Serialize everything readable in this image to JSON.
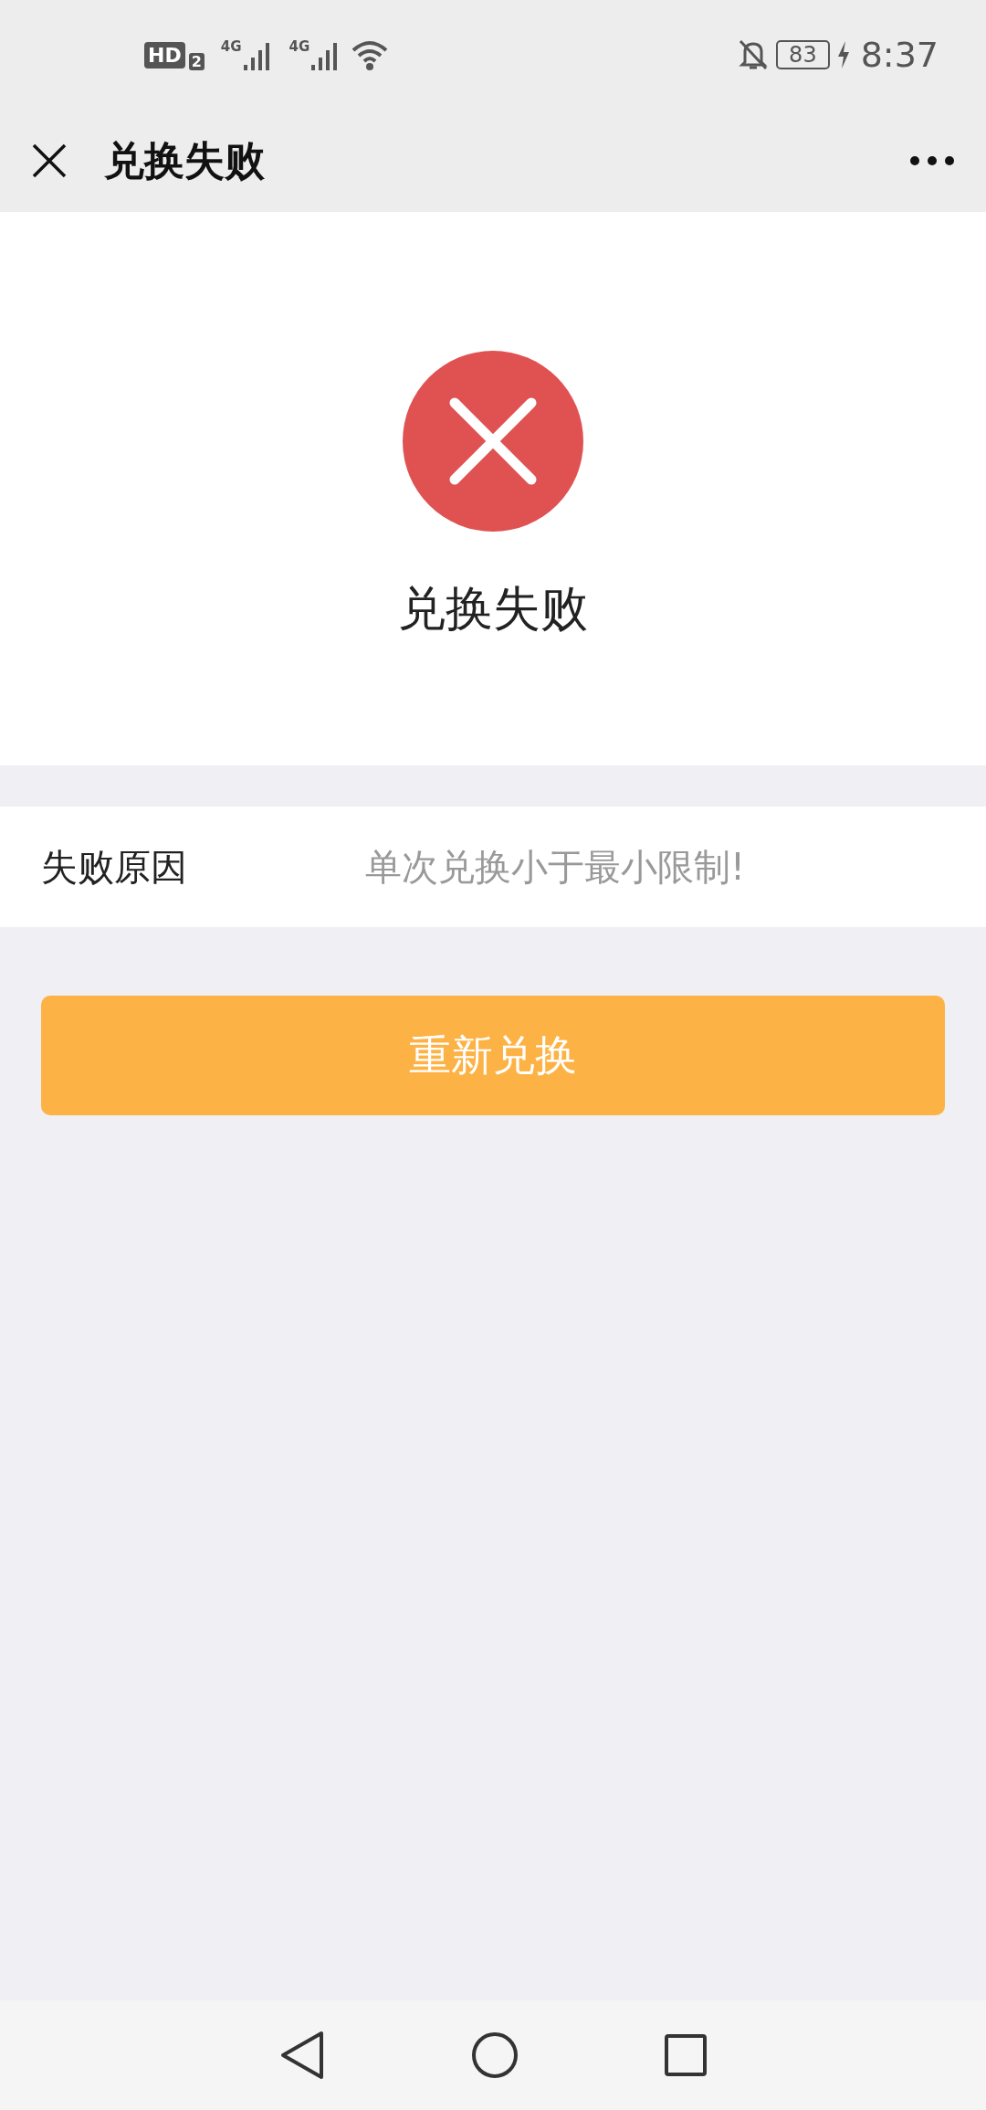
{
  "status_bar": {
    "hd_badge": "HD",
    "sim_number": "2",
    "network_1": "4G",
    "network_2": "4G",
    "battery": "83",
    "time": "8:37"
  },
  "title_bar": {
    "title": "兑换失败"
  },
  "result": {
    "kind": "failure",
    "message": "兑换失败"
  },
  "detail": {
    "label": "失败原因",
    "value": "单次兑换小于最小限制!"
  },
  "retry_button": "重新兑换"
}
